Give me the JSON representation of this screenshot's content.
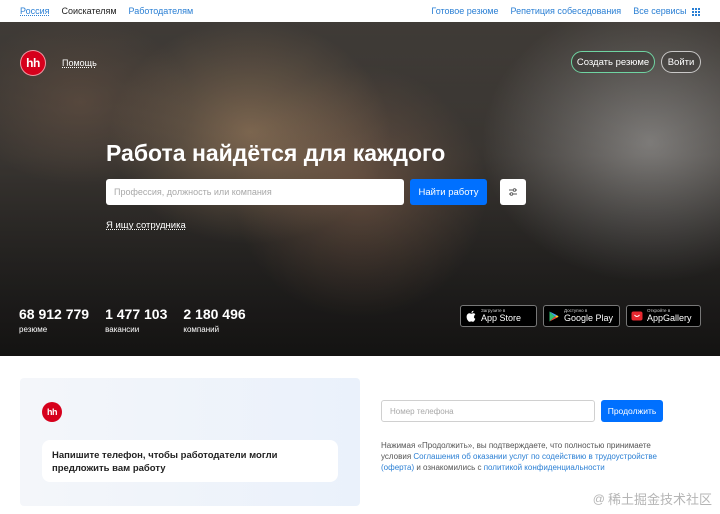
{
  "topbar": {
    "region": "Россия",
    "seekers": "Соискателям",
    "employers": "Работодателям",
    "ready_resume": "Готовое резюме",
    "interview_rehearsal": "Репетиция собеседования",
    "all_services": "Все сервисы"
  },
  "header": {
    "logo_text": "hh",
    "help": "Помощь",
    "create_resume": "Создать резюме",
    "login": "Войти"
  },
  "hero": {
    "title": "Работа найдётся для каждого",
    "search_placeholder": "Профессия, должность или компания",
    "find_button": "Найти работу",
    "employer_link": "Я ищу сотрудника"
  },
  "stats": [
    {
      "value": "68 912 779",
      "label": "резюме"
    },
    {
      "value": "1 477 103",
      "label": "вакансии"
    },
    {
      "value": "2 180 496",
      "label": "компаний"
    }
  ],
  "stores": {
    "apple": {
      "small": "Загрузите в",
      "big": "App Store"
    },
    "google": {
      "small": "Доступно в",
      "big": "Google Play"
    },
    "huawei": {
      "small": "Откройте в",
      "big": "AppGallery"
    }
  },
  "signup": {
    "logo_text": "hh",
    "card_text": "Напишите телефон, чтобы работодатели могли предложить вам работу",
    "phone_placeholder": "Номер телефона",
    "continue_button": "Продолжить",
    "legal_part1": "Нажимая «Продолжить», вы подтверждаете, что полностью принимаете условия ",
    "legal_link1": "Соглашения об оказании услуг по содействию в трудоустройстве (оферта)",
    "legal_part2": " и ознакомились с ",
    "legal_link2": "политикой конфиденциальности"
  },
  "watermark": {
    "at": "@",
    "text": "稀土掘金技术社区"
  },
  "colors": {
    "brand_red": "#d6001c",
    "primary_blue": "#0070ff",
    "link_blue": "#2a7fd4",
    "create_resume_border": "#6fd4a2"
  }
}
